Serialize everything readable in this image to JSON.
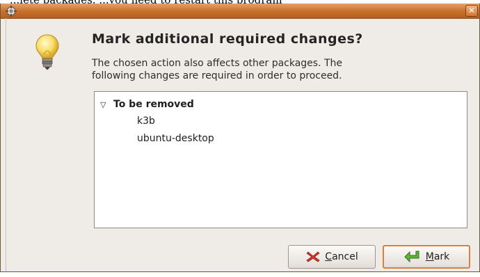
{
  "page_header": {
    "partial_text": "...lete packages. ...you need to restart this program"
  },
  "window": {
    "title": "",
    "close_glyph": "✕"
  },
  "dialog": {
    "heading": "Mark additional required changes?",
    "description_line1": "The chosen action also affects other packages. The",
    "description_line2": "following changes are required in order to proceed.",
    "icon": "lightbulb-icon"
  },
  "changes": {
    "groups": [
      {
        "label": "To be removed",
        "expanded": true,
        "items": [
          "k3b",
          "ubuntu-desktop"
        ]
      }
    ]
  },
  "buttons": {
    "cancel": {
      "mnemonic": "C",
      "rest": "ancel",
      "icon": "cancel-x-icon"
    },
    "mark": {
      "mnemonic": "M",
      "rest": "ark",
      "icon": "green-arrow-icon",
      "focused": true
    }
  },
  "colors": {
    "titlebar": "#c76f2a",
    "focus_border": "#e07e39",
    "window_bg": "#efebe7"
  }
}
